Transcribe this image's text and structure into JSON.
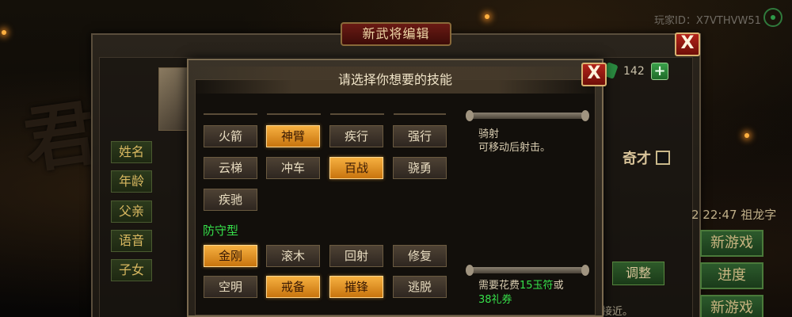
{
  "header": {
    "player_id": "玩家ID：X7VTHVW51",
    "background_glyph": "君"
  },
  "editor": {
    "title": "新武将编辑",
    "close_label": "X",
    "side_labels": [
      "姓名",
      "年龄",
      "父亲",
      "语音",
      "子女"
    ],
    "currency_count": "142",
    "plus_label": "+",
    "genius_label": "奇才",
    "adjust_label": "调整",
    "time_text": "2 22:47 祖龙字",
    "side_buttons": [
      "新游戏",
      "进度",
      "新游戏"
    ],
    "fragment_text": "接近。"
  },
  "dialog": {
    "title": "请选择你想要的技能",
    "close_label": "X",
    "attack_skills": [
      {
        "label": "火箭",
        "selected": false
      },
      {
        "label": "神臂",
        "selected": true
      },
      {
        "label": "疾行",
        "selected": false
      },
      {
        "label": "强行",
        "selected": false
      },
      {
        "label": "云梯",
        "selected": false
      },
      {
        "label": "冲车",
        "selected": false
      },
      {
        "label": "百战",
        "selected": true
      },
      {
        "label": "骁勇",
        "selected": false
      },
      {
        "label": "疾驰",
        "selected": false
      }
    ],
    "defense_category": "防守型",
    "defense_skills": [
      {
        "label": "金刚",
        "selected": true
      },
      {
        "label": "滚木",
        "selected": false
      },
      {
        "label": "回射",
        "selected": false
      },
      {
        "label": "修复",
        "selected": false
      },
      {
        "label": "空明",
        "selected": false
      },
      {
        "label": "戒备",
        "selected": true
      },
      {
        "label": "摧锋",
        "selected": true
      },
      {
        "label": "逃脱",
        "selected": false
      }
    ],
    "description": {
      "name": "骑射",
      "text": "可移动后射击。"
    },
    "cost": {
      "prefix": "需要花费",
      "jade_amount": "15玉符",
      "or_text": "或",
      "voucher_amount": "38礼券"
    }
  }
}
